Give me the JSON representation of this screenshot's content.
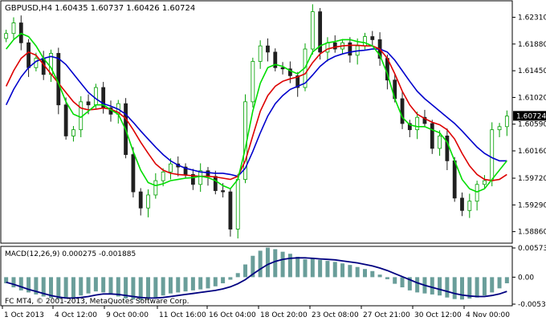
{
  "window": {
    "symbol_header": "GBPUSD,H4  1.60435 1.60737 1.60426 1.60724"
  },
  "price_axis": {
    "labels": [
      "1.62310",
      "1.61880",
      "1.61450",
      "1.61020",
      "1.60590",
      "1.60160",
      "1.59720",
      "1.59290",
      "1.58860"
    ],
    "current_price_label": "1.60724"
  },
  "macd_panel": {
    "header": "MACD(12,26,9) 0.000275 -0.001885",
    "axis_labels": [
      "0.005739",
      "0.00",
      "-0.005304"
    ],
    "copyright": "FC MT4, © 2001-2013, MetaQuotes Software Corp."
  },
  "time_axis": {
    "labels": [
      "1 Oct 2013",
      "4 Oct 12:00",
      "9 Oct 00:00",
      "11 Oct 16:00",
      "16 Oct 04:00",
      "18 Oct 20:00",
      "23 Oct 08:00",
      "27 Oct 21:00",
      "30 Oct 12:00",
      "4 Nov 00:00"
    ]
  },
  "colors": {
    "bull_candle": "#00a000",
    "bear_candle": "#202020",
    "ma_fast": "#00dd00",
    "ma_mid": "#dd0000",
    "ma_slow": "#0000cc",
    "macd_hist": "#6a9e9a",
    "macd_signal": "#000080",
    "grid_border": "#000000"
  },
  "chart_data": {
    "type": "line",
    "ylim": [
      1.587,
      1.6255
    ],
    "close": [
      1.6205,
      1.6222,
      1.619,
      1.615,
      1.6165,
      1.6139,
      1.6173,
      1.609,
      1.604,
      1.605,
      1.6095,
      1.609,
      1.6118,
      1.6085,
      1.6075,
      1.6092,
      1.601,
      1.595,
      1.5924,
      1.5945,
      1.5968,
      1.5982,
      1.5995,
      1.599,
      1.5978,
      1.5962,
      1.5984,
      1.5975,
      1.5952,
      1.595,
      1.589,
      1.597,
      1.6095,
      1.616,
      1.6185,
      1.6175,
      1.615,
      1.6148,
      1.6137,
      1.6118,
      1.618,
      1.624,
      1.6175,
      1.619,
      1.618,
      1.619,
      1.617,
      1.6185,
      1.62,
      1.6195,
      1.6165,
      1.613,
      1.61,
      1.606,
      1.605,
      1.607,
      1.606,
      1.602,
      1.604,
      1.6,
      1.594,
      1.592,
      1.5935,
      1.5962,
      1.5968,
      1.605,
      1.6055,
      1.6072
    ],
    "ma_fast": [
      1.618,
      1.6195,
      1.6205,
      1.62,
      1.6185,
      1.6165,
      1.615,
      1.6125,
      1.6095,
      1.6075,
      1.607,
      1.608,
      1.609,
      1.609,
      1.6082,
      1.6075,
      1.605,
      1.6015,
      1.5985,
      1.5965,
      1.596,
      1.5963,
      1.5968,
      1.597,
      1.5972,
      1.5973,
      1.5975,
      1.5973,
      1.5968,
      1.596,
      1.5955,
      1.597,
      1.602,
      1.608,
      1.6125,
      1.615,
      1.6155,
      1.6152,
      1.6145,
      1.614,
      1.615,
      1.6175,
      1.6185,
      1.619,
      1.6192,
      1.6195,
      1.6195,
      1.6192,
      1.619,
      1.6185,
      1.617,
      1.614,
      1.61,
      1.607,
      1.6058,
      1.6055,
      1.6055,
      1.605,
      1.6045,
      1.603,
      1.6,
      1.597,
      1.5955,
      1.595,
      1.5955,
      1.597,
      1.5985,
      1.6
    ],
    "ma_mid": [
      1.612,
      1.6145,
      1.6165,
      1.6175,
      1.617,
      1.6155,
      1.614,
      1.6125,
      1.611,
      1.6095,
      1.6085,
      1.6082,
      1.6083,
      1.6085,
      1.6083,
      1.6078,
      1.6068,
      1.605,
      1.603,
      1.6012,
      1.5995,
      1.5985,
      1.598,
      1.5978,
      1.5977,
      1.5976,
      1.5975,
      1.5975,
      1.5974,
      1.5972,
      1.597,
      1.5975,
      1.6,
      1.604,
      1.608,
      1.6105,
      1.612,
      1.6128,
      1.6132,
      1.6135,
      1.614,
      1.6158,
      1.6172,
      1.618,
      1.6183,
      1.6185,
      1.6186,
      1.6186,
      1.6185,
      1.6185,
      1.618,
      1.6165,
      1.614,
      1.6112,
      1.609,
      1.6075,
      1.6068,
      1.6062,
      1.6058,
      1.605,
      1.6035,
      1.6012,
      1.5992,
      1.5978,
      1.597,
      1.5968,
      1.597,
      1.5978
    ],
    "ma_slow": [
      1.609,
      1.6115,
      1.6135,
      1.615,
      1.616,
      1.6165,
      1.6168,
      1.6165,
      1.6155,
      1.614,
      1.6125,
      1.611,
      1.61,
      1.6092,
      1.6088,
      1.6083,
      1.6075,
      1.6062,
      1.6048,
      1.6035,
      1.6022,
      1.601,
      1.6,
      1.5993,
      1.5988,
      1.5985,
      1.5982,
      1.5981,
      1.598,
      1.598,
      1.5978,
      1.5975,
      1.5988,
      1.6015,
      1.6045,
      1.6072,
      1.6092,
      1.6105,
      1.6115,
      1.612,
      1.6125,
      1.6138,
      1.6152,
      1.6162,
      1.6168,
      1.6172,
      1.6175,
      1.6177,
      1.6178,
      1.618,
      1.618,
      1.6175,
      1.6162,
      1.6145,
      1.6128,
      1.6112,
      1.61,
      1.609,
      1.608,
      1.607,
      1.606,
      1.6048,
      1.6035,
      1.6022,
      1.6012,
      1.6005,
      1.6,
      1.6
    ],
    "macd_ylim": [
      -0.005304,
      0.005739
    ],
    "macd_hist": [
      -0.0012,
      -0.002,
      -0.0026,
      -0.003,
      -0.0034,
      -0.0038,
      -0.0041,
      -0.0043,
      -0.0042,
      -0.004,
      -0.0036,
      -0.0032,
      -0.0028,
      -0.003,
      -0.0034,
      -0.0038,
      -0.0042,
      -0.0044,
      -0.0045,
      -0.0043,
      -0.004,
      -0.0036,
      -0.0032,
      -0.003,
      -0.0028,
      -0.0026,
      -0.0024,
      -0.0022,
      -0.0018,
      -0.0012,
      -0.0005,
      0.0008,
      0.0025,
      0.0042,
      0.0052,
      0.0058,
      0.0055,
      0.005,
      0.0046,
      0.004,
      0.0035,
      0.0036,
      0.0034,
      0.0032,
      0.003,
      0.0027,
      0.0024,
      0.002,
      0.0016,
      0.0012,
      0.0005,
      -0.0004,
      -0.0013,
      -0.002,
      -0.0026,
      -0.003,
      -0.0032,
      -0.0034,
      -0.0036,
      -0.004,
      -0.0043,
      -0.0044,
      -0.0042,
      -0.004,
      -0.0036,
      -0.003,
      -0.0022,
      -0.0012
    ],
    "macd_signal": [
      -0.001,
      -0.0014,
      -0.0019,
      -0.0024,
      -0.0028,
      -0.0032,
      -0.0036,
      -0.0039,
      -0.0041,
      -0.0041,
      -0.004,
      -0.0038,
      -0.0035,
      -0.0033,
      -0.0033,
      -0.0034,
      -0.0036,
      -0.0038,
      -0.004,
      -0.0041,
      -0.0041,
      -0.004,
      -0.0038,
      -0.0036,
      -0.0034,
      -0.0032,
      -0.003,
      -0.0028,
      -0.0026,
      -0.0023,
      -0.0019,
      -0.0013,
      -0.0005,
      0.0006,
      0.0016,
      0.0025,
      0.0031,
      0.0035,
      0.0037,
      0.0038,
      0.0038,
      0.0037,
      0.0036,
      0.0035,
      0.0034,
      0.0032,
      0.003,
      0.0028,
      0.0025,
      0.0022,
      0.0018,
      0.0013,
      0.0007,
      0.0001,
      -0.0005,
      -0.0011,
      -0.0016,
      -0.002,
      -0.0024,
      -0.0028,
      -0.0032,
      -0.0035,
      -0.0037,
      -0.0038,
      -0.0038,
      -0.0036,
      -0.0033,
      -0.0028
    ]
  }
}
